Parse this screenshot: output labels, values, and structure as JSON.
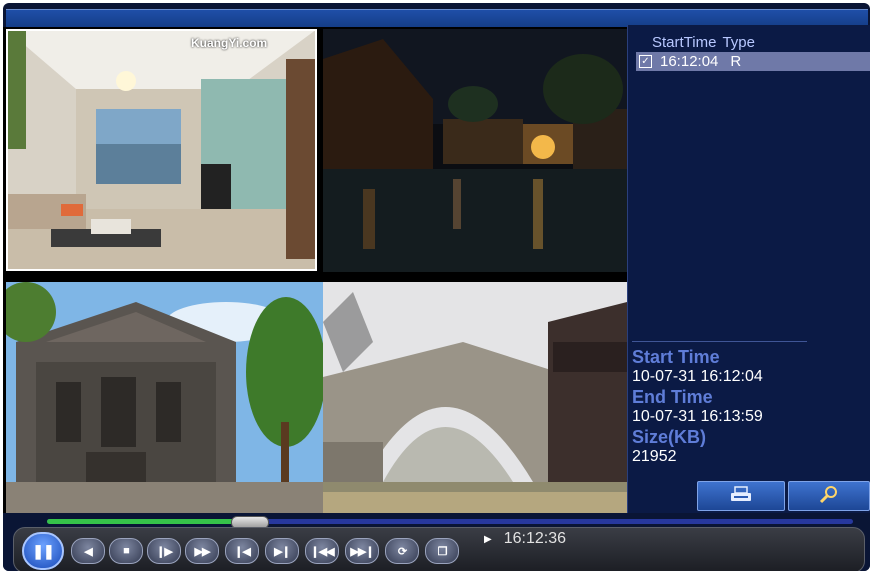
{
  "watermark": "KuangYi.com",
  "file_list": {
    "header_col1": "StartTime",
    "header_col2": "Type",
    "rows": [
      {
        "checked": true,
        "time": "16:12:04",
        "type": "R"
      }
    ]
  },
  "file_info": {
    "start_label": "Start Time",
    "start_value": "10-07-31 16:12:04",
    "end_label": "End Time",
    "end_value": "10-07-31 16:13:59",
    "size_label": "Size(KB)",
    "size_value": "21952"
  },
  "panel_buttons": [
    {
      "icon": "backup-icon"
    },
    {
      "icon": "search-icon"
    }
  ],
  "playback": {
    "progress": 0.25,
    "current_time": "16:12:36",
    "buttons": [
      {
        "icon": "pause-icon",
        "glyph": "❚❚"
      },
      {
        "icon": "reverse-play-icon",
        "glyph": "◀"
      },
      {
        "icon": "stop-icon",
        "glyph": "■"
      },
      {
        "icon": "slow-play-icon",
        "glyph": "❙▶"
      },
      {
        "icon": "fast-forward-icon",
        "glyph": "▶▶"
      },
      {
        "icon": "previous-frame-icon",
        "glyph": "❙◀"
      },
      {
        "icon": "next-frame-icon",
        "glyph": "▶❙"
      },
      {
        "icon": "previous-file-icon",
        "glyph": "❙◀◀"
      },
      {
        "icon": "next-file-icon",
        "glyph": "▶▶❙"
      },
      {
        "icon": "loop-icon",
        "glyph": "⟳"
      },
      {
        "icon": "fullscreen-icon",
        "glyph": "❐"
      }
    ]
  },
  "colors": {
    "panel_bg": "#0b1a45",
    "label_blue": "#5f7dd8",
    "selected_row": "#6f79a8",
    "progress_green": "#36c24a"
  }
}
